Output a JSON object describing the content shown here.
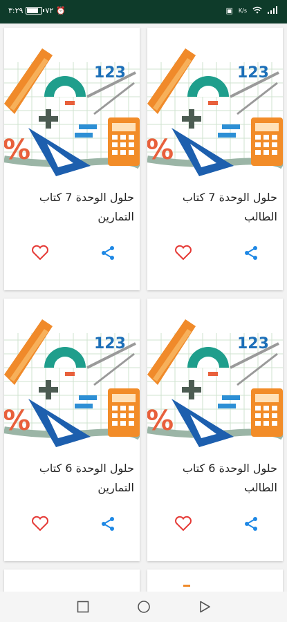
{
  "status_bar": {
    "time": "٣:٢٩",
    "battery_text": "٧٢",
    "battery_level": 0.72,
    "network_label": "K/s"
  },
  "cards": [
    {
      "title": "حلول الوحدة 7 كتاب الطالب",
      "like_icon": "heart-outline-icon",
      "share_icon": "share-icon"
    },
    {
      "title": "حلول الوحدة 7 كتاب التمارين",
      "like_icon": "heart-outline-icon",
      "share_icon": "share-icon"
    },
    {
      "title": "حلول الوحدة 6 كتاب الطالب",
      "like_icon": "heart-outline-icon",
      "share_icon": "share-icon"
    },
    {
      "title": "حلول الوحدة 6 كتاب التمارين",
      "like_icon": "heart-outline-icon",
      "share_icon": "share-icon"
    }
  ],
  "thumbnail": {
    "number_text": "123",
    "percent_text": "%"
  },
  "nav_bar": {
    "buttons": [
      "recent-apps-icon",
      "home-icon",
      "back-icon"
    ]
  },
  "colors": {
    "status_bar_bg": "#0e3b2a",
    "heart": "#e53935",
    "share": "#1e88e5"
  }
}
